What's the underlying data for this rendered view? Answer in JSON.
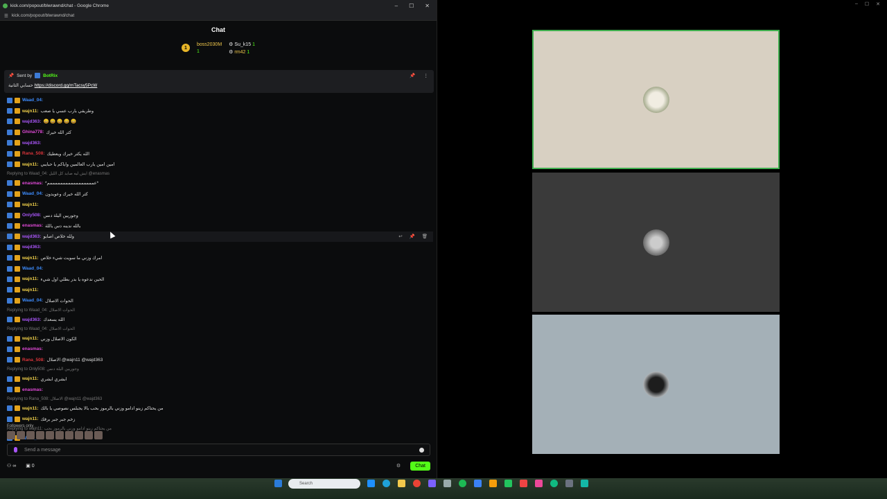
{
  "window": {
    "title": "kick.com/popout/blwrawnd/chat - Google Chrome",
    "url": "kick.com/popout/blwrawnd/chat",
    "controls": [
      "–",
      "☐",
      "✕"
    ]
  },
  "chat": {
    "title": "Chat",
    "leaderboard": [
      {
        "name": "boss2030M",
        "count": "1"
      },
      {
        "name": "Su_k15",
        "count": "1"
      },
      {
        "name": "rm42",
        "count": "1"
      }
    ],
    "pinned": {
      "sent_by_label": "Sent by",
      "sender": "BotRix",
      "link_prefix": "حسابي الثانية",
      "link": "https://discord.gg/mTacsy5PcW"
    },
    "messages": [
      {
        "user": "Waad_04:",
        "color": "blue",
        "text": ""
      },
      {
        "user": "wajn11:",
        "color": "yellow",
        "text": "وطريقي بارب عسي يا صعب"
      },
      {
        "user": "wajd363:",
        "color": "purple",
        "text": "😄 😄 😄 😄 😄"
      },
      {
        "user": "Ghina778:",
        "color": "pink",
        "text": "كثر الله خيرك"
      },
      {
        "user": "wajd363:",
        "color": "purple",
        "text": ""
      },
      {
        "user": "Rana_508:",
        "color": "red",
        "text": "الله يكثر خيرك ويعطيك"
      },
      {
        "user": "wajn11:",
        "color": "yellow",
        "text": "امين امين يارب العالمين واياكم يا حبايبي"
      },
      {
        "user": "",
        "color": "reply",
        "text": "Replying to Waad_04: ايش ليه صايد كل الليل @enasmas"
      },
      {
        "user": "enasmas:",
        "color": "pink",
        "text": "*عمممممممممممممممممم*"
      },
      {
        "user": "Waad_04:",
        "color": "blue",
        "text": "كثر الله خيرك وعويدون"
      },
      {
        "user": "wajn11:",
        "color": "yellow",
        "text": ""
      },
      {
        "user": "Only508:",
        "color": "purple",
        "text": "وجوريين اليلة دنس"
      },
      {
        "user": "enasmas:",
        "color": "pink",
        "text": "بالله ندينه دس ياللة"
      },
      {
        "user": "wajd363:",
        "color": "purple",
        "text": "ولله خلاص اصابو"
      },
      {
        "user": "wajd363:",
        "color": "purple",
        "text": ""
      },
      {
        "user": "wajn11:",
        "color": "yellow",
        "text": "امرك وزني ما سويت شيء خلاص"
      },
      {
        "user": "Waad_04:",
        "color": "blue",
        "text": ""
      },
      {
        "user": "wajn11:",
        "color": "yellow",
        "text": "الحين ندعوه يا بدر بطلي اول شيء"
      },
      {
        "user": "wajn11:",
        "color": "yellow",
        "text": ""
      },
      {
        "user": "Waad_04:",
        "color": "blue",
        "text": "الحوات الاصلال"
      },
      {
        "user": "",
        "color": "reply",
        "text": "Replying to Waad_04: الحوات الاصلال"
      },
      {
        "user": "wajd363:",
        "color": "purple",
        "text": "الله يسعدك"
      },
      {
        "user": "",
        "color": "reply",
        "text": "Replying to Waad_04: الحوات الاصلال"
      },
      {
        "user": "wajn11:",
        "color": "yellow",
        "text": "الكون الاصلال وزني"
      },
      {
        "user": "enasmas:",
        "color": "pink",
        "text": ""
      },
      {
        "user": "Rana_508:",
        "color": "red",
        "text": "الاصلال @wajn11 @wajd363"
      },
      {
        "user": "",
        "color": "reply",
        "text": "Replying to Only508: وجوريين اليلة دنس"
      },
      {
        "user": "wajn11:",
        "color": "yellow",
        "text": "ابشري ابشري"
      },
      {
        "user": "enasmas:",
        "color": "pink",
        "text": ""
      },
      {
        "user": "",
        "color": "reply",
        "text": "Replying to Rana_508: الاصلال @wajn11 @wajd363"
      },
      {
        "user": "wajn11:",
        "color": "yellow",
        "text": "من يحتاكم زينو ادامو وزني بالرموز بحب بالا يجبلس نصوصي يا بالك"
      },
      {
        "user": "wajn11:",
        "color": "yellow",
        "text": "زخم جبر جبر برقك"
      },
      {
        "user": "",
        "color": "reply",
        "text": "Replying to wajn11: من يحتاكم زينو ادامو وزني بالرموز بحب"
      },
      {
        "user": "Waad_04:",
        "color": "blue",
        "text": ""
      }
    ],
    "followers_only": "Followers only",
    "input_placeholder": "Send a message",
    "viewers": "∞",
    "count": "0",
    "chat_button": "Chat"
  },
  "taskbar": {
    "search_placeholder": "Search"
  },
  "colors": {
    "accent": "#53fc18",
    "tile1": "#d8d0c2",
    "tile2": "#3a3a3a",
    "tile3": "#a4b0b7"
  }
}
